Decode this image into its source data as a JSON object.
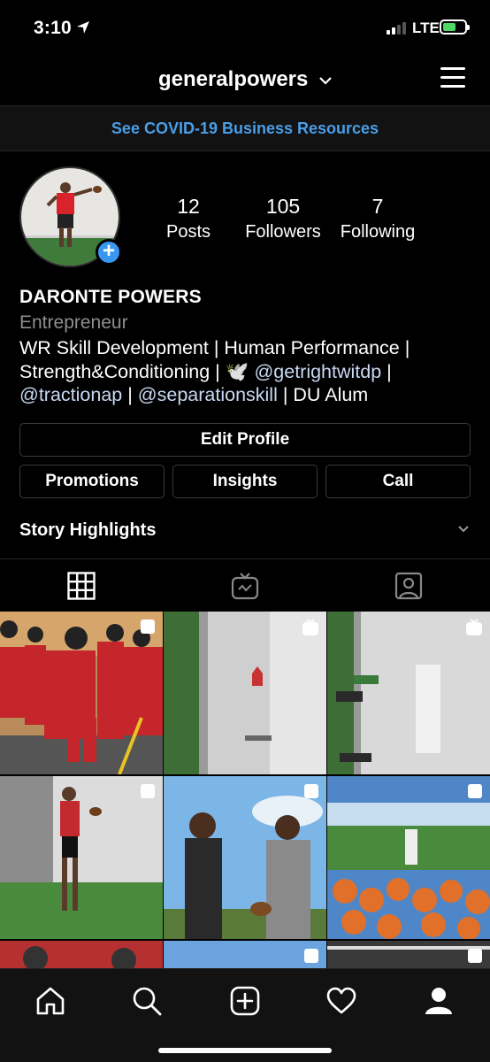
{
  "status_bar": {
    "time": "3:10",
    "network": "LTE",
    "battery_percent": 60
  },
  "header": {
    "username": "generalpowers"
  },
  "banner": {
    "text": "See COVID-19 Business Resources"
  },
  "profile": {
    "stats": [
      {
        "number": "12",
        "label": "Posts"
      },
      {
        "number": "105",
        "label": "Followers"
      },
      {
        "number": "7",
        "label": "Following"
      }
    ],
    "full_name": "DARONTE POWERS",
    "category": "Entrepreneur",
    "bio": {
      "line1": "WR Skill Development | Human Performance |",
      "line2_prefix": "Strength&Conditioning | ",
      "line2_emoji": "🕊️",
      "line2_mention": "@getrightwitdp",
      "line2_suffix": " |",
      "line3_mention1": "@tractionap",
      "line3_sep": " | ",
      "line3_mention2": "@separationskill",
      "line3_suffix": " | DU Alum"
    }
  },
  "buttons": {
    "edit_profile": "Edit Profile",
    "promotions": "Promotions",
    "insights": "Insights",
    "call": "Call"
  },
  "story_highlights": {
    "label": "Story Highlights"
  },
  "tabs": [
    "grid-icon",
    "igtv-icon",
    "tagged-icon"
  ],
  "colors": {
    "accent": "#3897f0",
    "link": "#4a9ee8",
    "background": "#000000"
  }
}
